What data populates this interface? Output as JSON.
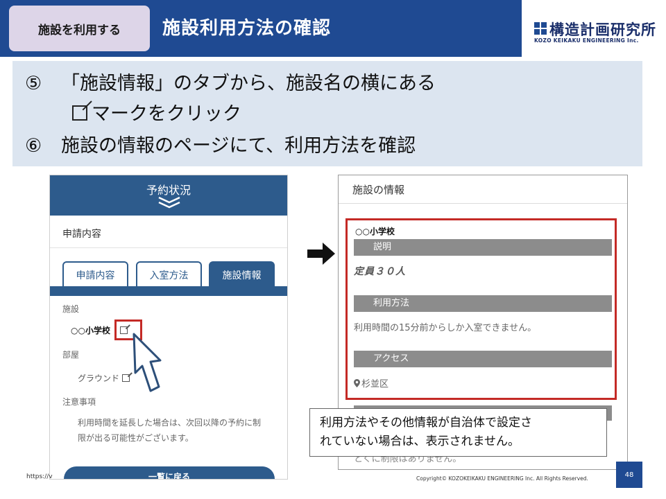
{
  "header": {
    "section_badge": "施設を利用する",
    "title": "施設利用方法の確認",
    "logo_jp": "構造計画研究所",
    "logo_en": "KOZO KEIKAKU ENGINEERING Inc.",
    "colors": {
      "header_bg": "#1f4a92",
      "badge_bg": "#ddd5e8"
    }
  },
  "instructions": {
    "step5_num": "⑤",
    "step5_line1": "「施設情報」のタブから、施設名の横にある",
    "step5_line2": "マークをクリック",
    "step6_num": "⑥",
    "step6_line": "施設の情報のページにて、利用方法を確認"
  },
  "phone": {
    "top_title": "予約状況",
    "chevron_icon": "double-chevron-down-icon",
    "apply_heading": "申請内容",
    "tabs": [
      {
        "label": "申請内容",
        "active": false
      },
      {
        "label": "入室方法",
        "active": false
      },
      {
        "label": "施設情報",
        "active": true
      }
    ],
    "facility_label": "施設",
    "facility_name": "○○小学校",
    "room_label": "部屋",
    "room_value": "グラウンド",
    "notes_label": "注意事項",
    "notes_text": "利用時間を延長した場合は、次回以降の予約に制限が出る可能性がございます。",
    "back_button": "一覧に戻る",
    "url_stub": "https://v"
  },
  "detail": {
    "title": "施設の情報",
    "facility_name": "○○小学校",
    "description_heading": "説明",
    "capacity": "定員３０人",
    "usage_heading": "利用方法",
    "usage_text": "利用時間の15分前からしか入室できません。",
    "access_heading": "アクセス",
    "access_text": "杉並区",
    "behind_text": "とくに制限はありません。"
  },
  "callout": {
    "line1": "利用方法やその他情報が自治体で設定さ",
    "line2": "れていない場合は、表示されません。"
  },
  "footer": {
    "copyright": "Copyright© KOZOKEIKAKU ENGINEERING Inc. All Rights Reserved.",
    "page_number": "48"
  },
  "accent_color": "#c42a26"
}
